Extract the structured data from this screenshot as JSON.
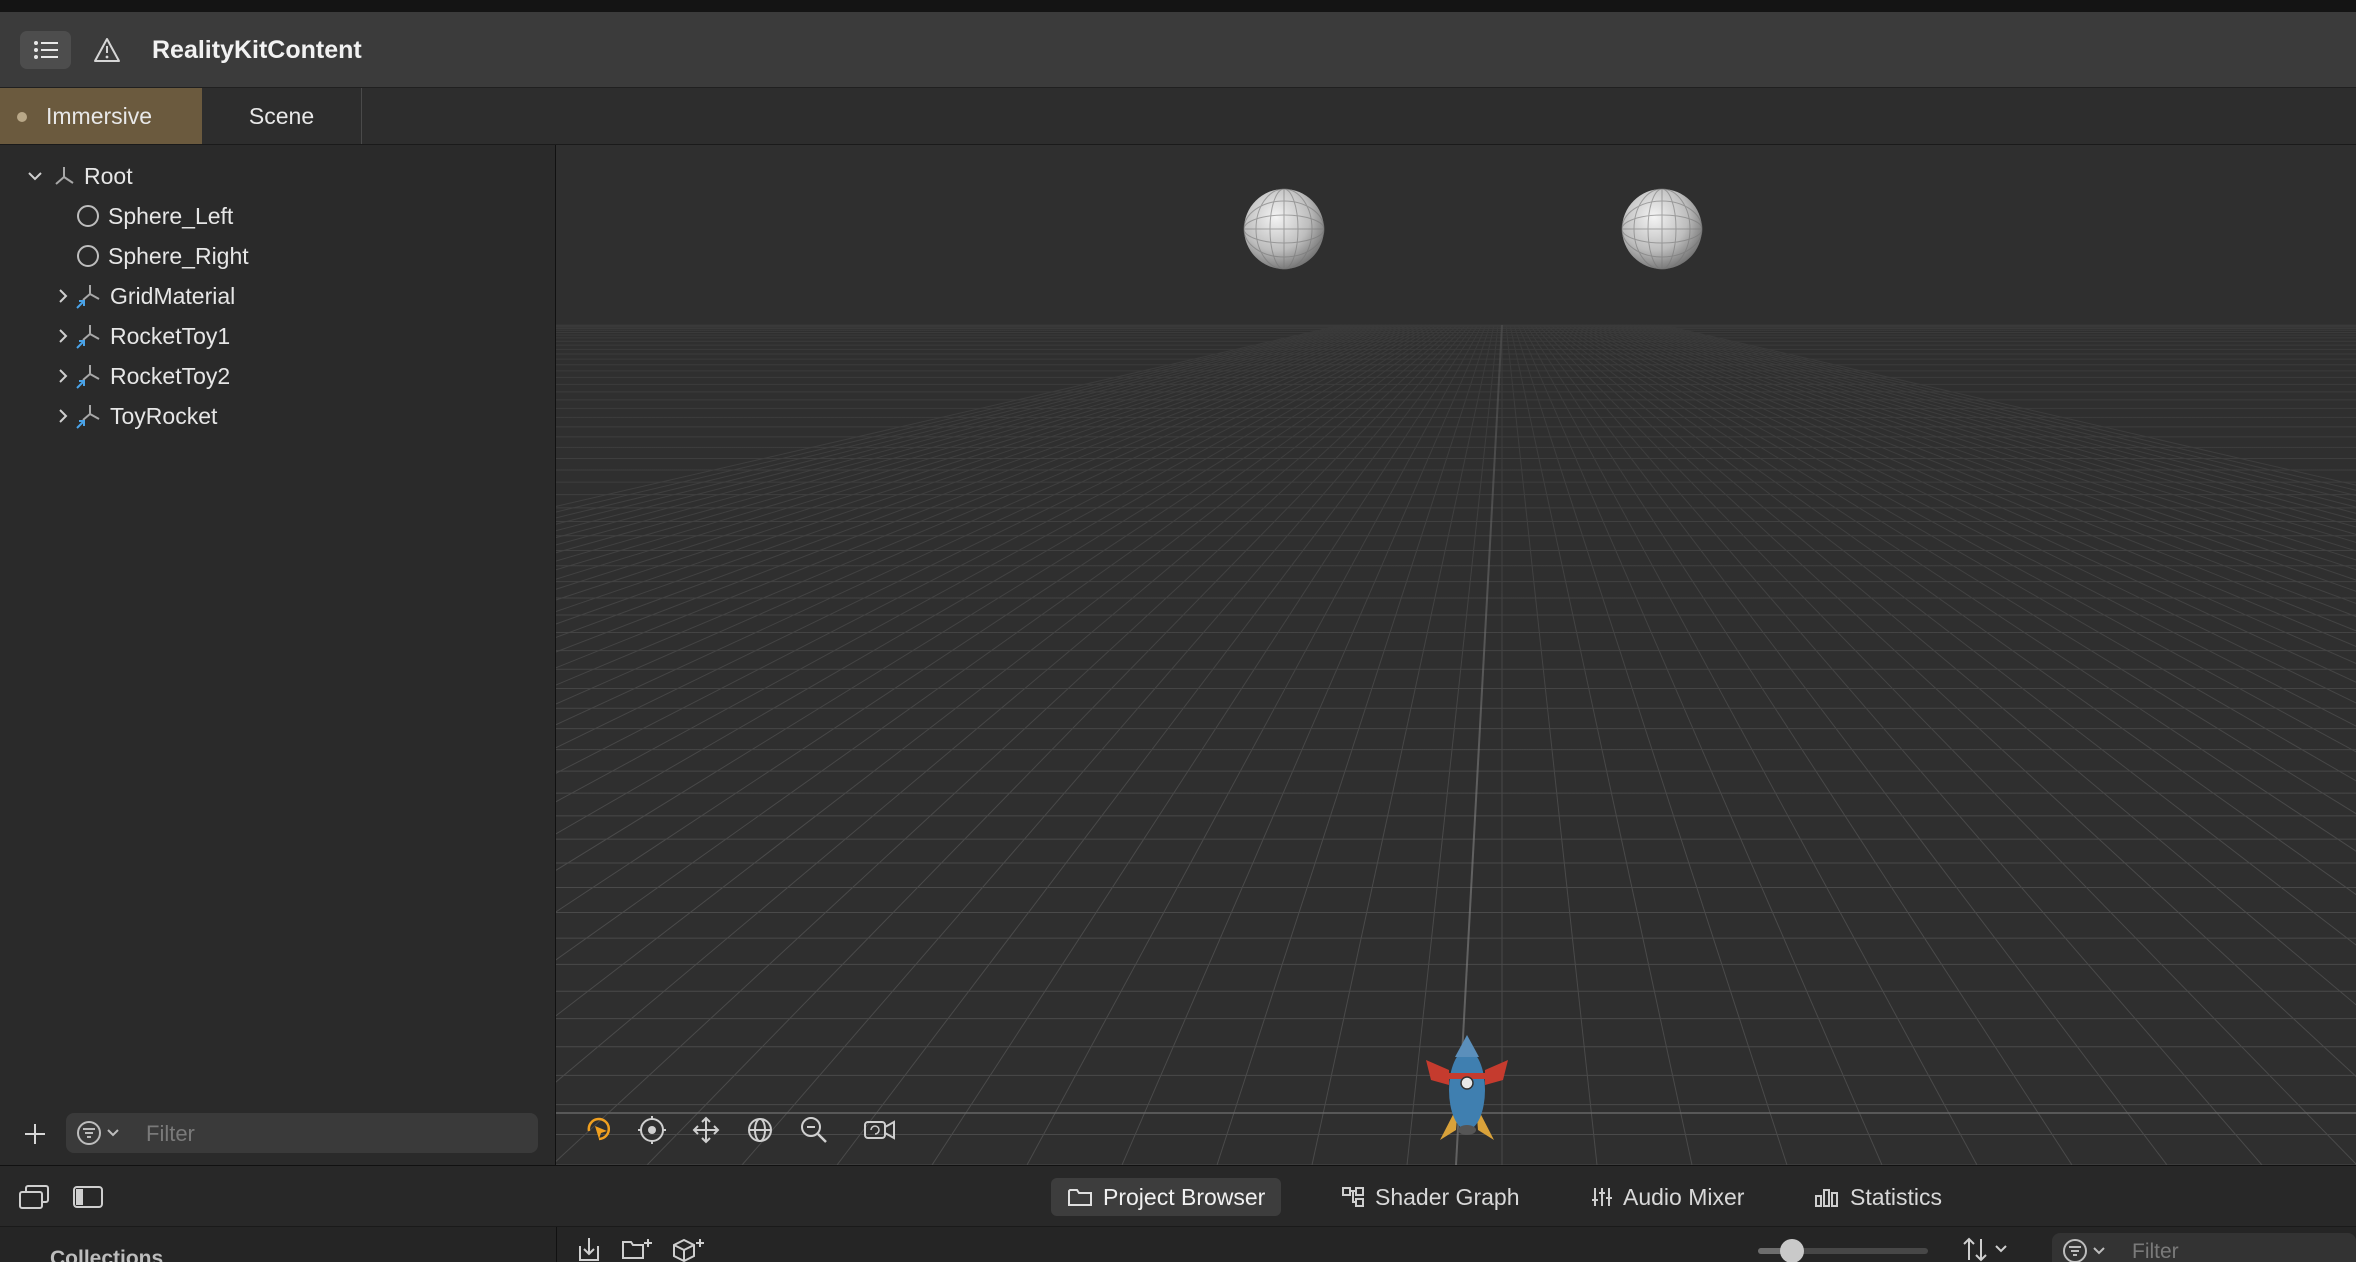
{
  "window": {
    "title": "RealityKitContent"
  },
  "toolbar": {
    "sidebar_toggle_icon": "list-icon",
    "issues_icon": "warning-triangle-icon"
  },
  "tabs": [
    {
      "label": "Immersive",
      "active": true
    },
    {
      "label": "Scene",
      "active": false
    }
  ],
  "hierarchy": {
    "root": {
      "label": "Root",
      "expanded": true,
      "icon": "transform-axes-icon"
    },
    "items": [
      {
        "label": "Sphere_Left",
        "icon": "sphere-icon",
        "expandable": false
      },
      {
        "label": "Sphere_Right",
        "icon": "sphere-icon",
        "expandable": false
      },
      {
        "label": "GridMaterial",
        "icon": "usd-reference-icon",
        "expandable": true
      },
      {
        "label": "RocketToy1",
        "icon": "usd-reference-icon",
        "expandable": true
      },
      {
        "label": "RocketToy2",
        "icon": "usd-reference-icon",
        "expandable": true
      },
      {
        "label": "ToyRocket",
        "icon": "usd-reference-icon",
        "expandable": true
      }
    ],
    "filter_placeholder": "Filter"
  },
  "viewport": {
    "controls": [
      "select-tool-icon",
      "orbit-icon",
      "pan-icon",
      "dolly-icon",
      "zoom-icon",
      "camera-icon"
    ],
    "active_control": "select-tool-icon",
    "accent_color": "#f0a020"
  },
  "bottom_tabs": [
    {
      "label": "Project Browser",
      "icon": "folder-icon",
      "active": true
    },
    {
      "label": "Shader Graph",
      "icon": "node-graph-icon",
      "active": false
    },
    {
      "label": "Audio Mixer",
      "icon": "sliders-icon",
      "active": false
    },
    {
      "label": "Statistics",
      "icon": "bar-chart-icon",
      "active": false
    }
  ],
  "project_browser": {
    "collections_label": "Collections",
    "toolbar_icons": [
      "import-icon",
      "new-folder-icon",
      "add-object-icon"
    ],
    "zoom_fraction": 0.2,
    "filter_placeholder": "Filter"
  },
  "colors": {
    "active_tab": "#6b5a3e",
    "panel": "#2a2a2a",
    "viewport": "#2f2f2f",
    "accent": "#f0a020"
  }
}
